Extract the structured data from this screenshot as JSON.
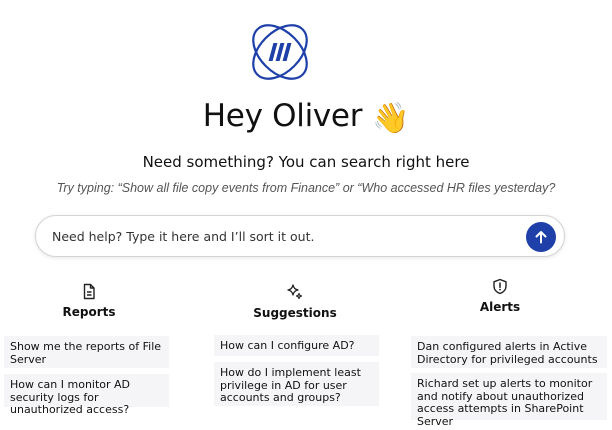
{
  "greeting": {
    "text": "Hey Oliver",
    "emoji": "👋"
  },
  "headline": "Need something? You can search right here",
  "hint": "Try typing: “Show all file copy events from Finance” or “Who accessed HR files yesterday?",
  "search": {
    "placeholder": "Need help? Type it here and I’ll sort it out."
  },
  "colors": {
    "accent": "#1e40a8",
    "card_bg": "#f5f5f7"
  },
  "columns": [
    {
      "title": "Reports",
      "icon": "document-icon",
      "items": [
        "Show me the reports of File Server",
        "How can I monitor AD security logs for unauthorized access?"
      ]
    },
    {
      "title": "Suggestions",
      "icon": "sparkles-icon",
      "items": [
        "How can I configure AD?",
        "How do I implement least privilege in AD for user accounts and groups?"
      ]
    },
    {
      "title": "Alerts",
      "icon": "shield-alert-icon",
      "items": [
        "Dan configured alerts in Active Directory for privileged accounts",
        "Richard set up alerts to monitor and notify about unauthorized access attempts in SharePoint Server"
      ]
    }
  ]
}
